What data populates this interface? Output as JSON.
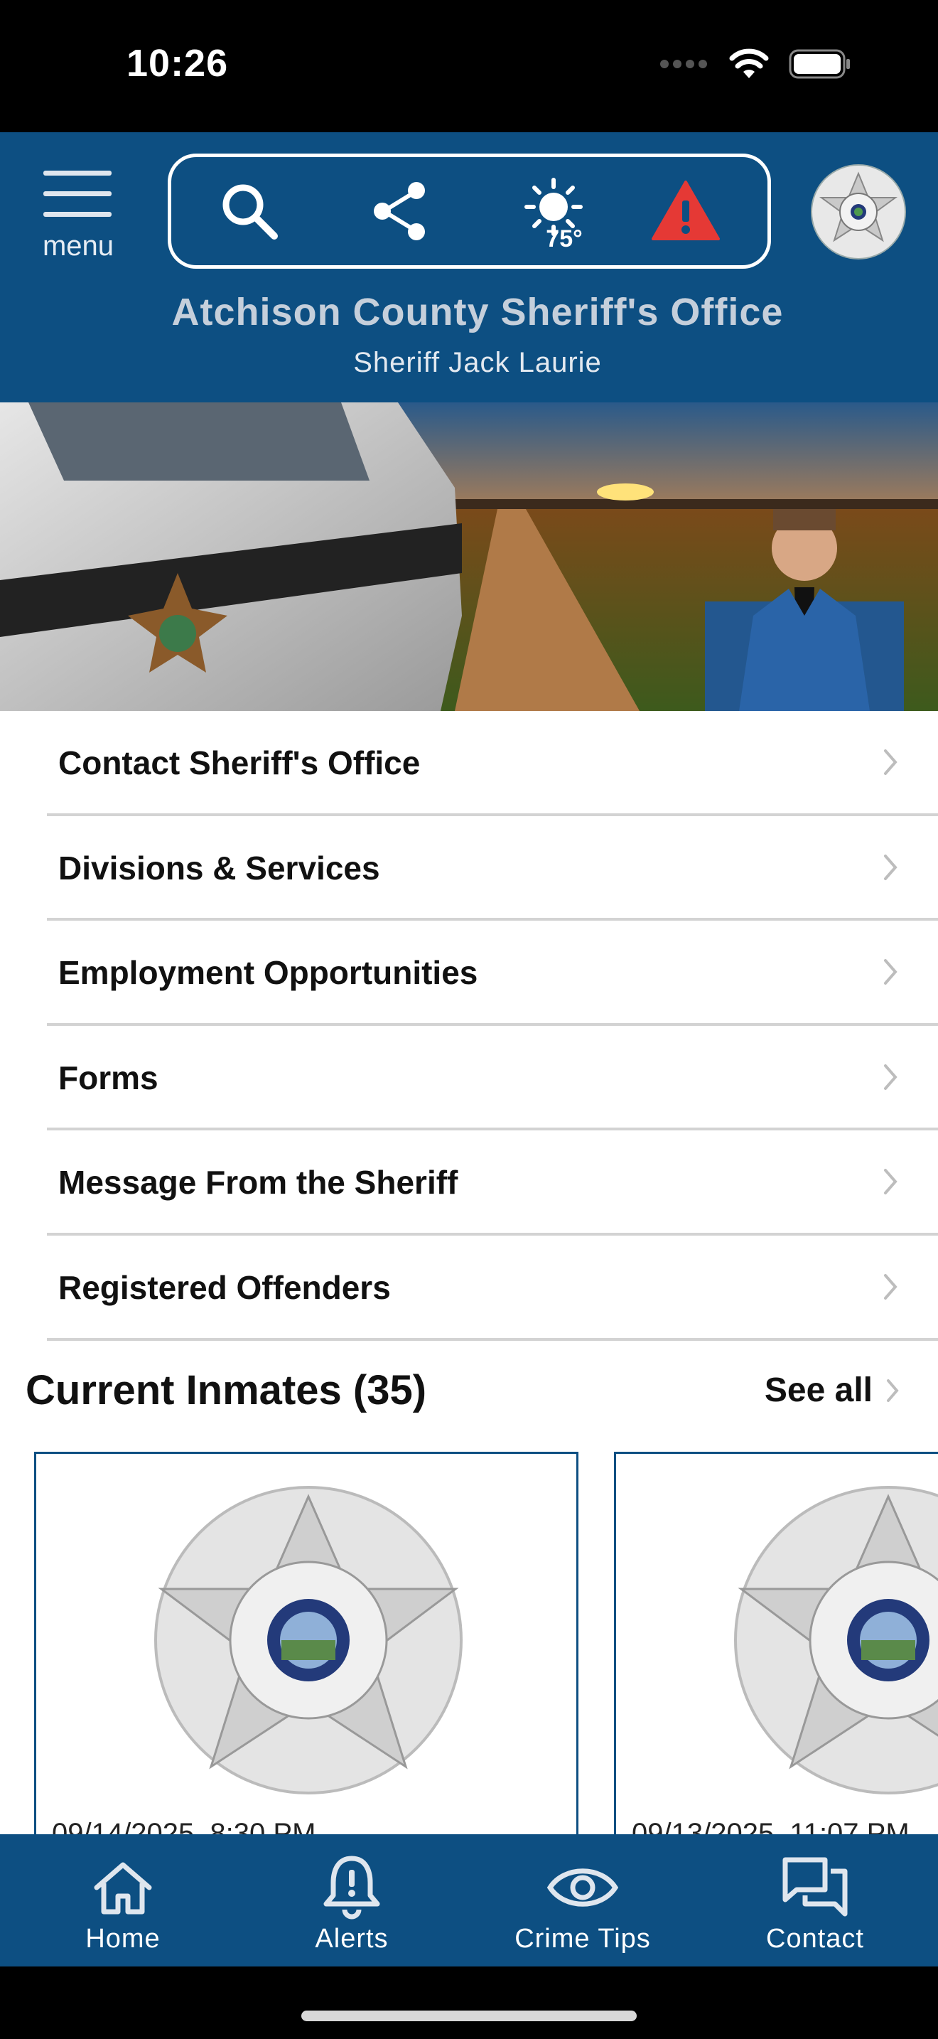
{
  "status_bar": {
    "time": "10:26"
  },
  "header": {
    "menu_label": "menu",
    "temperature": "75°",
    "title": "Atchison County Sheriff's Office",
    "subtitle": "Sheriff Jack Laurie",
    "colors": {
      "brand": "#0d4f82",
      "alert": "#e53935"
    },
    "icons": [
      "search-icon",
      "share-icon",
      "sun-icon",
      "warning-icon",
      "sheriff-badge-logo"
    ]
  },
  "menu_items": [
    {
      "label": "Contact Sheriff's Office"
    },
    {
      "label": "Divisions & Services"
    },
    {
      "label": "Employment Opportunities"
    },
    {
      "label": "Forms"
    },
    {
      "label": "Message From the Sheriff"
    },
    {
      "label": "Registered Offenders"
    }
  ],
  "inmates": {
    "title": "Current Inmates (35)",
    "see_all": "See all",
    "cards": [
      {
        "date": "09/14/2025, 8:30 PM"
      },
      {
        "date": "09/13/2025, 11:07 PM"
      }
    ]
  },
  "tabbar": {
    "tabs": [
      {
        "label": "Home",
        "icon": "home-icon"
      },
      {
        "label": "Alerts",
        "icon": "bell-alert-icon"
      },
      {
        "label": "Crime Tips",
        "icon": "eye-icon"
      },
      {
        "label": "Contact",
        "icon": "chat-icon"
      }
    ]
  }
}
